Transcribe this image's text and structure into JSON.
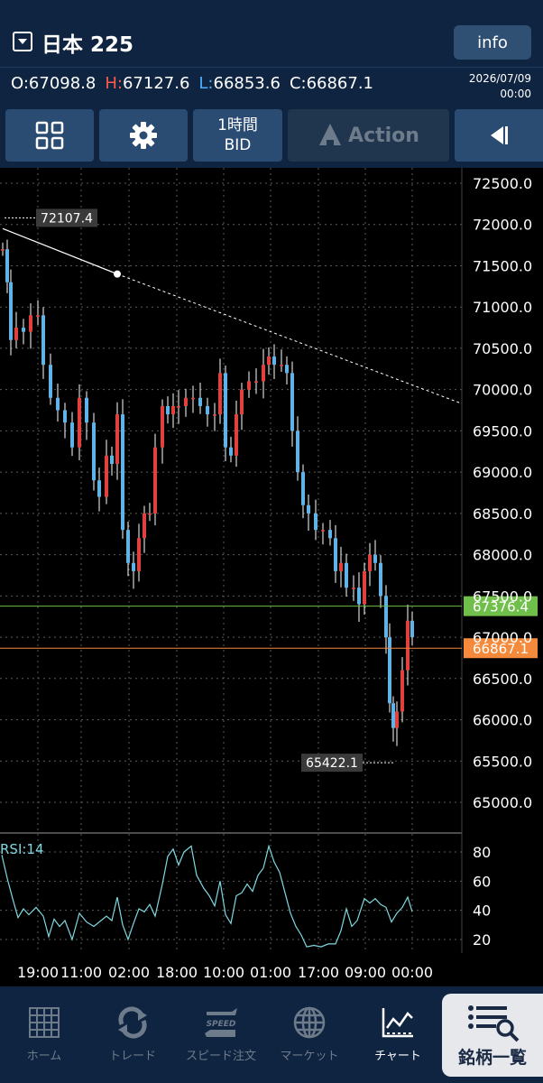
{
  "header": {
    "symbol": "日本 225",
    "info_label": "info",
    "ohlc": {
      "o_label": "O:",
      "o_value": "67098.8",
      "h_label": "H:",
      "h_value": "67127.6",
      "l_label": "L:",
      "l_value": "66853.6",
      "c_label": "C:",
      "c_value": "66867.1"
    },
    "date": "2026/07/09",
    "time": "00:00"
  },
  "toolbar": {
    "timeframe": "1時間",
    "price_type": "BID",
    "action_label": "Action"
  },
  "chart": {
    "y_ticks": [
      "72500.0",
      "72000.0",
      "71500.0",
      "71000.0",
      "70500.0",
      "70000.0",
      "69500.0",
      "69000.0",
      "68500.0",
      "68000.0",
      "67500.0",
      "67000.0",
      "66500.0",
      "66000.0",
      "65500.0",
      "65000.0"
    ],
    "y_tick_values": [
      72500,
      72000,
      71500,
      71000,
      70500,
      70000,
      69500,
      69000,
      68500,
      68000,
      67500,
      67000,
      66500,
      66000,
      65500,
      65000
    ],
    "x_ticks": [
      "19:00",
      "11:00",
      "02:00",
      "18:00",
      "10:00",
      "01:00",
      "17:00",
      "09:00",
      "00:00"
    ],
    "high_label": "72107.4",
    "low_label": "65422.1",
    "green_line_label": "67376.4",
    "orange_line_label": "66867.1",
    "rsi_label": "RSI:14",
    "rsi_ticks": [
      "80",
      "60",
      "40",
      "20"
    ],
    "colors": {
      "up": "#e2403c",
      "down": "#5fb3e6",
      "grid": "#5a5a5a",
      "green_line": "#6fbf4a",
      "orange_line": "#f58a3c",
      "rsi_line": "#7fd8e0",
      "axis_text": "#ffffff"
    }
  },
  "nav": [
    {
      "label": "ホーム",
      "icon": "home-grid-icon"
    },
    {
      "label": "トレード",
      "icon": "trade-cycle-icon"
    },
    {
      "label": "スピード注文",
      "icon": "speed-order-icon"
    },
    {
      "label": "マーケット",
      "icon": "globe-icon"
    },
    {
      "label": "チャート",
      "icon": "chart-icon"
    }
  ],
  "nav_list_label": "銘柄一覧"
}
